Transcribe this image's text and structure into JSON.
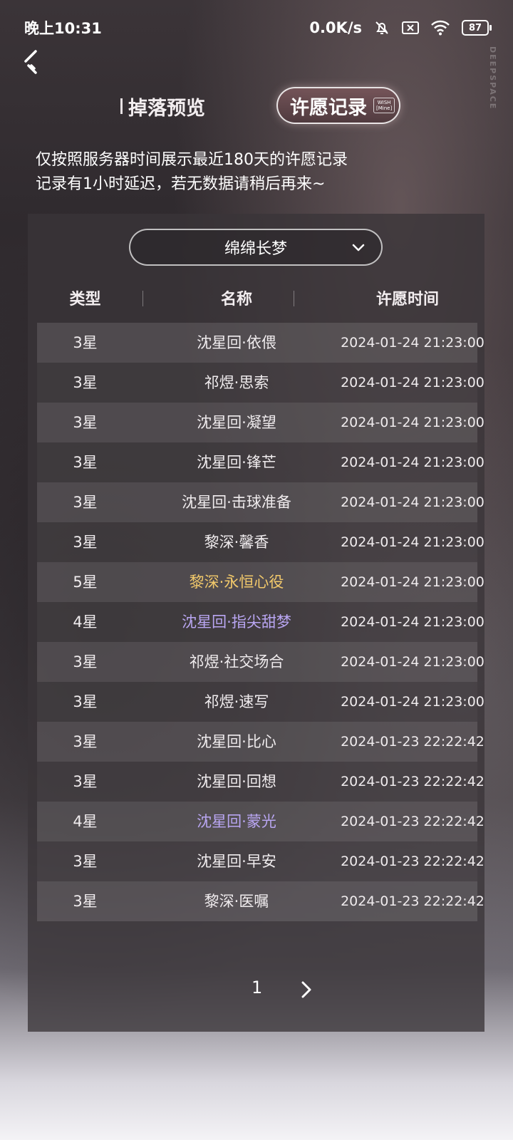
{
  "status": {
    "time": "晚上10:31",
    "network_speed": "0.0K/s",
    "battery": "87",
    "icons": [
      "bell-off-icon",
      "sim-none-icon",
      "wifi-icon",
      "battery-icon"
    ]
  },
  "brand_vertical": "DEEPSPACE",
  "tabs": {
    "drops_label": "掉落预览",
    "wish_label": "许愿记录",
    "wish_tag_line1": "WISH",
    "wish_tag_line2": "[Mine]"
  },
  "notice": {
    "line1": "仅按照服务器时间展示最近180天的许愿记录",
    "line2": "记录有1小时延迟，若无数据请稍后再来~"
  },
  "pool_select": {
    "value": "绵绵长梦"
  },
  "table": {
    "headers": [
      "类型",
      "名称",
      "许愿时间"
    ],
    "rows": [
      {
        "type": "3星",
        "name": "沈星回·依偎",
        "time": "2024-01-24 21:23:00",
        "color": "#f0ecee"
      },
      {
        "type": "3星",
        "name": "祁煜·思索",
        "time": "2024-01-24 21:23:00",
        "color": "#f0ecee"
      },
      {
        "type": "3星",
        "name": "沈星回·凝望",
        "time": "2024-01-24 21:23:00",
        "color": "#f0ecee"
      },
      {
        "type": "3星",
        "name": "沈星回·锋芒",
        "time": "2024-01-24 21:23:00",
        "color": "#f0ecee"
      },
      {
        "type": "3星",
        "name": "沈星回·击球准备",
        "time": "2024-01-24 21:23:00",
        "color": "#f0ecee"
      },
      {
        "type": "3星",
        "name": "黎深·馨香",
        "time": "2024-01-24 21:23:00",
        "color": "#f0ecee"
      },
      {
        "type": "5星",
        "name": "黎深·永恒心役",
        "time": "2024-01-24 21:23:00",
        "color": "#f2c96b"
      },
      {
        "type": "4星",
        "name": "沈星回·指尖甜梦",
        "time": "2024-01-24 21:23:00",
        "color": "#b9a6f2"
      },
      {
        "type": "3星",
        "name": "祁煜·社交场合",
        "time": "2024-01-24 21:23:00",
        "color": "#f0ecee"
      },
      {
        "type": "3星",
        "name": "祁煜·速写",
        "time": "2024-01-24 21:23:00",
        "color": "#f0ecee"
      },
      {
        "type": "3星",
        "name": "沈星回·比心",
        "time": "2024-01-23 22:22:42",
        "color": "#f0ecee"
      },
      {
        "type": "3星",
        "name": "沈星回·回想",
        "time": "2024-01-23 22:22:42",
        "color": "#f0ecee"
      },
      {
        "type": "4星",
        "name": "沈星回·蒙光",
        "time": "2024-01-23 22:22:42",
        "color": "#b9a6f2"
      },
      {
        "type": "3星",
        "name": "沈星回·早安",
        "time": "2024-01-23 22:22:42",
        "color": "#f0ecee"
      },
      {
        "type": "3星",
        "name": "黎深·医嘱",
        "time": "2024-01-23 22:22:42",
        "color": "#f0ecee"
      }
    ]
  },
  "pagination": {
    "current_page": "1"
  }
}
